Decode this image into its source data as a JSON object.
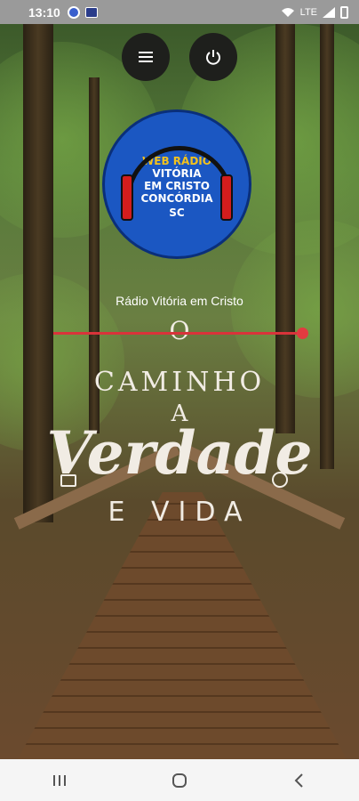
{
  "status_bar": {
    "time": "13:10",
    "right_text": "LTE"
  },
  "station": {
    "name": "Rádio Vitória em Cristo",
    "volume": 0.98
  },
  "logo": {
    "line1": "WEB RÁDIO",
    "line2": "VITÓRIA",
    "line3": "EM CRISTO",
    "line4": "CONCÓRDIA",
    "line5": "SC"
  },
  "slogan": {
    "line1": "O",
    "line2": "CAMINHO",
    "line3": "A",
    "line4": "Verdade",
    "line5": "E VIDA"
  },
  "icons": {
    "menu": "menu-icon",
    "power": "power-icon"
  },
  "colors": {
    "accent": "#d9333a",
    "logo_bg": "#1b57c2",
    "logo_text_yellow": "#f3c21d"
  }
}
